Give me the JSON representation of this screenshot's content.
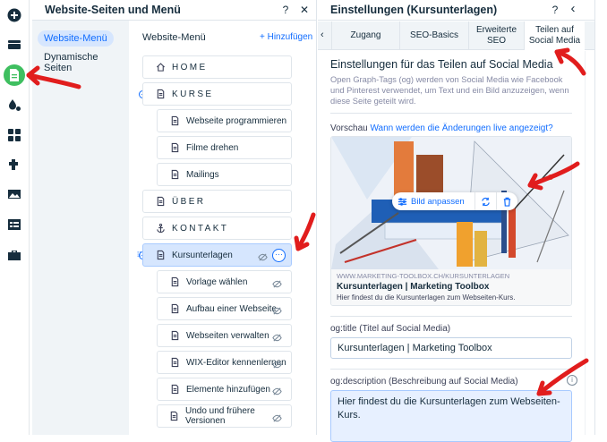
{
  "rail": {
    "items": [
      {
        "icon": "add-icon"
      },
      {
        "icon": "sections-icon"
      },
      {
        "icon": "pages-icon",
        "active": true
      },
      {
        "icon": "design-icon"
      },
      {
        "icon": "apps-icon"
      },
      {
        "icon": "app-market-icon"
      },
      {
        "icon": "media-icon"
      },
      {
        "icon": "cms-icon"
      },
      {
        "icon": "business-icon"
      }
    ]
  },
  "pages_panel": {
    "title": "Website-Seiten und Menü",
    "help": "?",
    "close": "✕",
    "nav": [
      {
        "label": "Website-Menü",
        "active": true
      },
      {
        "label": "Dynamische Seiten",
        "active": false
      }
    ],
    "menu_title": "Website-Menü",
    "add_label": "+ Hinzufügen",
    "rows": [
      {
        "label": "HOME",
        "type": "home"
      },
      {
        "label": "KURSE",
        "type": "page"
      },
      {
        "label": "Webseite programmieren",
        "type": "page"
      },
      {
        "label": "Filme drehen",
        "type": "page"
      },
      {
        "label": "Mailings",
        "type": "page"
      },
      {
        "label": "ÜBER",
        "type": "page"
      },
      {
        "label": "KONTAKT",
        "type": "anchor"
      },
      {
        "label": "Kursunterlagen",
        "type": "page"
      },
      {
        "label": "Vorlage wählen",
        "type": "page"
      },
      {
        "label": "Aufbau einer Webseite",
        "type": "page"
      },
      {
        "label": "Webseiten verwalten",
        "type": "page"
      },
      {
        "label": "WIX-Editor kennenlernen",
        "type": "page"
      },
      {
        "label": "Elemente hinzufügen",
        "type": "page"
      },
      {
        "label": "Undo und frühere Versionen",
        "type": "page"
      }
    ]
  },
  "settings_panel": {
    "title": "Einstellungen (Kursunterlagen)",
    "help": "?",
    "back": "‹",
    "tab_back": "‹",
    "tabs": [
      {
        "label": "Zugang"
      },
      {
        "label": "SEO-Basics"
      },
      {
        "label": "Erweiterte SEO"
      },
      {
        "label": "Teilen auf Social Media",
        "active": true
      }
    ],
    "section_title": "Einstellungen für das Teilen auf Social Media",
    "section_desc": "Open Graph-Tags (og) werden von Social Media wie Facebook und Pinterest verwendet, um Text und ein Bild anzuzeigen, wenn diese Seite geteilt wird.",
    "preview_label": "Vorschau",
    "preview_link": "Wann werden die Änderungen live angezeigt?",
    "image_action": "Bild anpassen",
    "preview_url": "WWW.MARKETING-TOOLBOX.CH/KURSUNTERLAGEN",
    "preview_title": "Kursunterlagen | Marketing Toolbox",
    "preview_desc": "Hier findest du die Kursunterlagen zum Webseiten-Kurs.",
    "og_title_label": "og:title (Titel auf Social Media)",
    "og_title_value": "Kursunterlagen | Marketing Toolbox",
    "og_desc_label": "og:description (Beschreibung auf Social Media)",
    "og_desc_value": "Hier findest du die Kursunterlagen zum Webseiten-Kurs.",
    "info": "i"
  },
  "colors": {
    "accent": "#116dff",
    "selected_bg": "#d6e6fe",
    "rail_active": "#3fbf60",
    "annotation": "#e11d1d"
  }
}
